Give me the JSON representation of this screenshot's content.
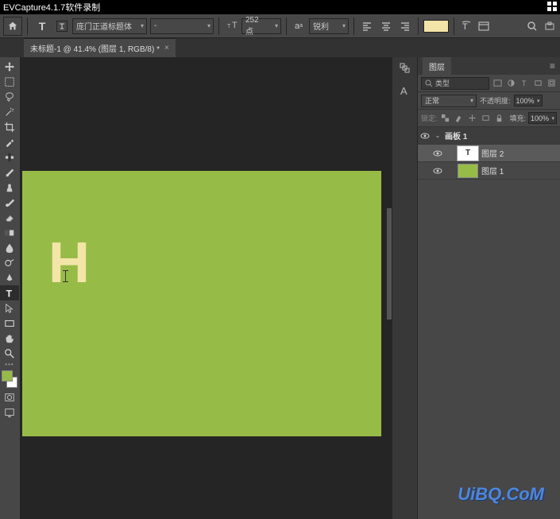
{
  "title": "EVCapture4.1.7软件录制",
  "doc_tab": {
    "label": "未标题-1 @ 41.4% (图层 1, RGB/8) *"
  },
  "options": {
    "font_family": "庞门正道标题体",
    "font_style": "-",
    "font_size": "252 点",
    "aa_mode": "锐利"
  },
  "canvas": {
    "text": "H"
  },
  "layers_panel": {
    "tab_label": "图层",
    "filter_kind": "类型",
    "blend_mode": "正常",
    "opacity_label": "不透明度:",
    "opacity_value": "100%",
    "lock_label": "锁定:",
    "fill_label": "填充:",
    "fill_value": "100%",
    "artboard": "画板 1",
    "layers": [
      {
        "name": "图层 2",
        "type": "text",
        "thumb": "T",
        "selected": true
      },
      {
        "name": "图层 1",
        "type": "solid",
        "thumb": "",
        "selected": false
      }
    ]
  },
  "watermark": "UiBQ.CoM"
}
